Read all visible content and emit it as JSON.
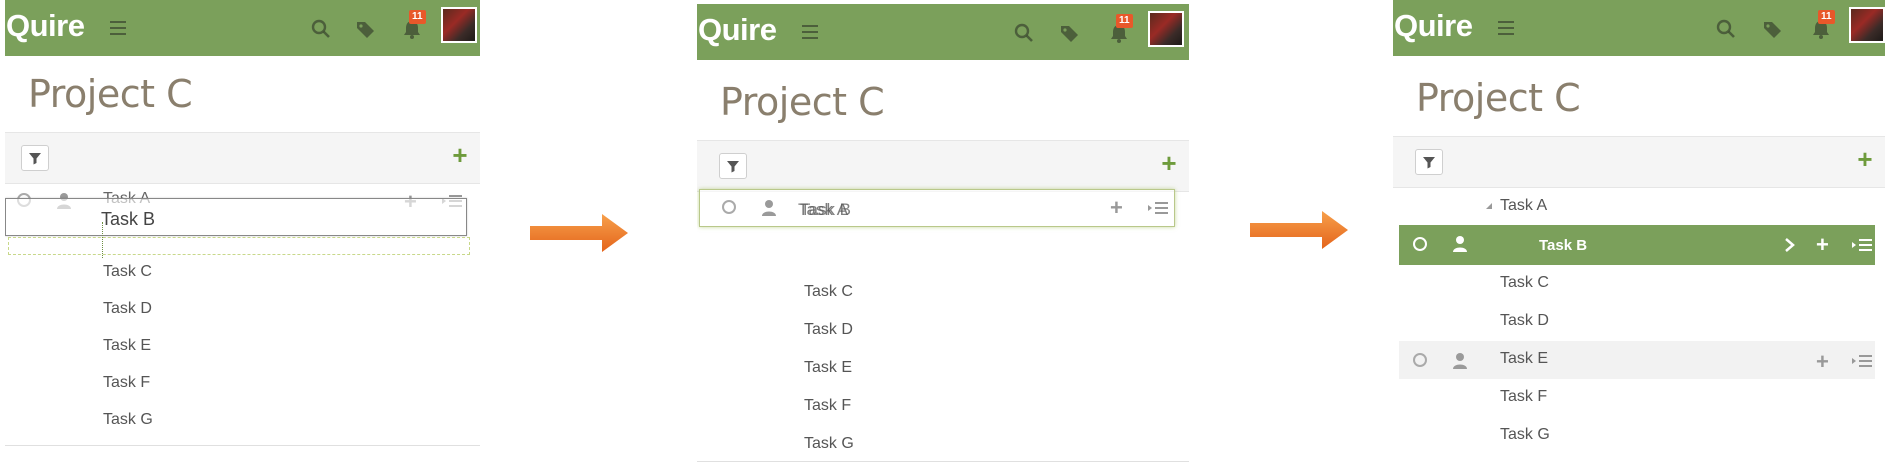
{
  "app": {
    "logo": "Quire",
    "notification_count": "11",
    "accent": "#7ba05b",
    "badge_color": "#e8582a"
  },
  "project": {
    "title": "Project C"
  },
  "icons": [
    "menu-icon",
    "search-icon",
    "tags-icon",
    "bell-icon",
    "filter-icon",
    "plus-icon",
    "user-icon",
    "circle-check-icon",
    "add-subtask-icon",
    "chevron-right-icon",
    "arrow-right-icon",
    "expand-triangle-icon"
  ],
  "panel1": {
    "tasks": [
      "Task A",
      "Task C",
      "Task D",
      "Task E",
      "Task F",
      "Task G"
    ],
    "dragging": "Task B"
  },
  "panel2": {
    "tasks": [
      "Task C",
      "Task D",
      "Task E",
      "Task F",
      "Task G"
    ],
    "overlap_a": "Task A",
    "overlap_b": "Task B"
  },
  "panel3": {
    "tasks": [
      "Task A",
      "Task B",
      "Task C",
      "Task D",
      "Task E",
      "Task F",
      "Task G"
    ]
  }
}
